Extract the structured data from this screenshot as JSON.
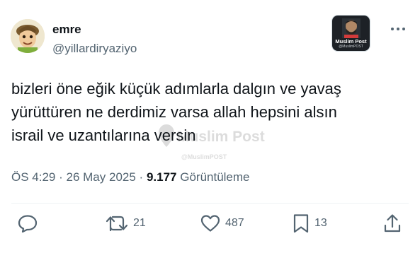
{
  "author": {
    "display_name": "emre",
    "handle": "@yillardiryaziyo"
  },
  "badge": {
    "title": "Muslim Post",
    "subtitle": "@MuslimPOST"
  },
  "watermark": {
    "title": "Muslim Post",
    "subtitle": "@MuslimPOST"
  },
  "tweet": {
    "lines": [
      "bizleri öne eğik küçük adımlarla dalgın ve yavaş",
      "yürüttüren ne derdimiz varsa allah hepsini alsın",
      "israil ve uzantılarına versin"
    ],
    "time": "ÖS 4:29",
    "separator": "·",
    "date": "26 May 2025",
    "views_count": "9.177",
    "views_label": "Görüntüleme"
  },
  "actions": {
    "reply_icon": "reply-icon",
    "retweet_icon": "retweet-icon",
    "retweet_count": "21",
    "like_icon": "like-icon",
    "like_count": "487",
    "bookmark_icon": "bookmark-icon",
    "bookmark_count": "13",
    "share_icon": "share-icon"
  },
  "colors": {
    "text_primary": "#0f1419",
    "text_secondary": "#536471",
    "divider": "#eff3f4",
    "background": "#ffffff"
  }
}
